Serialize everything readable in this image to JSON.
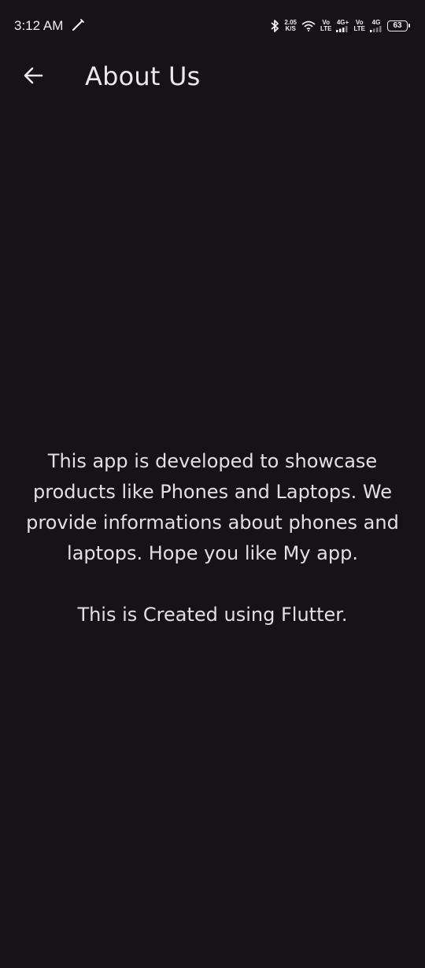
{
  "status_bar": {
    "time": "3:12 AM",
    "speed_value": "2.05",
    "speed_unit": "K/S",
    "sim1_label_top": "Vo",
    "sim1_label_bottom": "LTE",
    "sim1_net": "4G+",
    "sim2_label_top": "Vo",
    "sim2_label_bottom": "LTE",
    "sim2_net": "4G",
    "battery": "63"
  },
  "app_bar": {
    "title": "About Us",
    "back_icon": "arrow-back-icon"
  },
  "content": {
    "description": "This app is developed to showcase products like Phones and Laptops. We provide informations about phones and laptops. Hope you like My app.",
    "credit": "This is Created using Flutter."
  }
}
